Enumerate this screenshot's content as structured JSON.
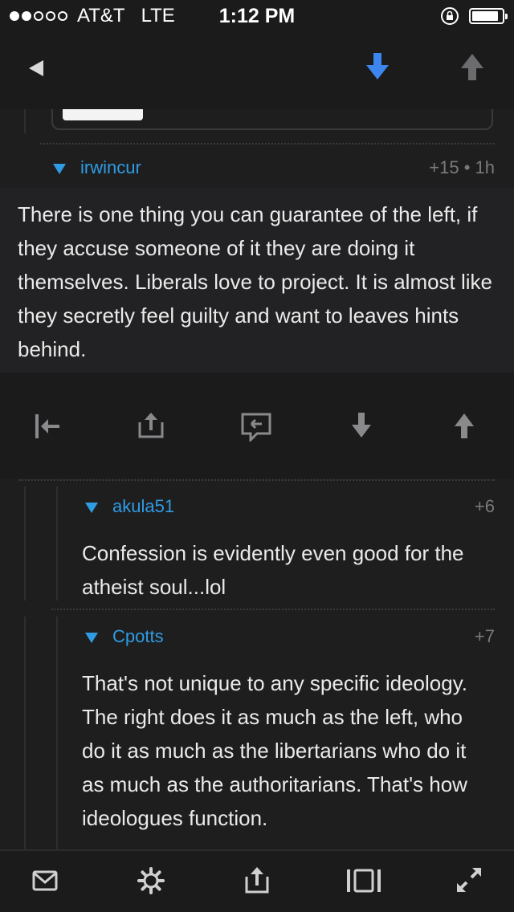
{
  "status": {
    "signal_dots": [
      true,
      true,
      false,
      false,
      false
    ],
    "carrier": "AT&T",
    "network": "LTE",
    "time": "1:12 PM",
    "battery_level": 0.9
  },
  "nav": {
    "back_icon": "back-triangle-icon",
    "downvote_icon": "arrow-down-icon",
    "upvote_icon": "arrow-up-icon",
    "accent": "#3d86f0"
  },
  "comments": [
    {
      "username": "irwincur",
      "meta": "+15 • 1h",
      "body": "There is one thing you can guarantee of the left, if they accuse someone of it they are doing it themselves. Liberals love to project. It is almost like they secretly feel guilty and want to leaves hints behind."
    },
    {
      "username": "akula51",
      "meta": "+6",
      "body": "Confession is evidently even good for the atheist soul...lol"
    },
    {
      "username": "Cpotts",
      "meta": "+7",
      "body": "That's not unique to any specific ideology. The right does it as much as the left, who do it as much as the libertarians who do it as much as the authoritarians. That's how ideologues function."
    }
  ],
  "actions": [
    "collapse-icon",
    "share-icon",
    "reply-icon",
    "arrow-down-icon",
    "arrow-up-icon"
  ],
  "bottom": [
    "mail-icon",
    "gear-icon",
    "share-icon",
    "pages-icon",
    "expand-icon"
  ],
  "colors": {
    "username": "#2f9be3",
    "background": "#1b1b1c"
  }
}
